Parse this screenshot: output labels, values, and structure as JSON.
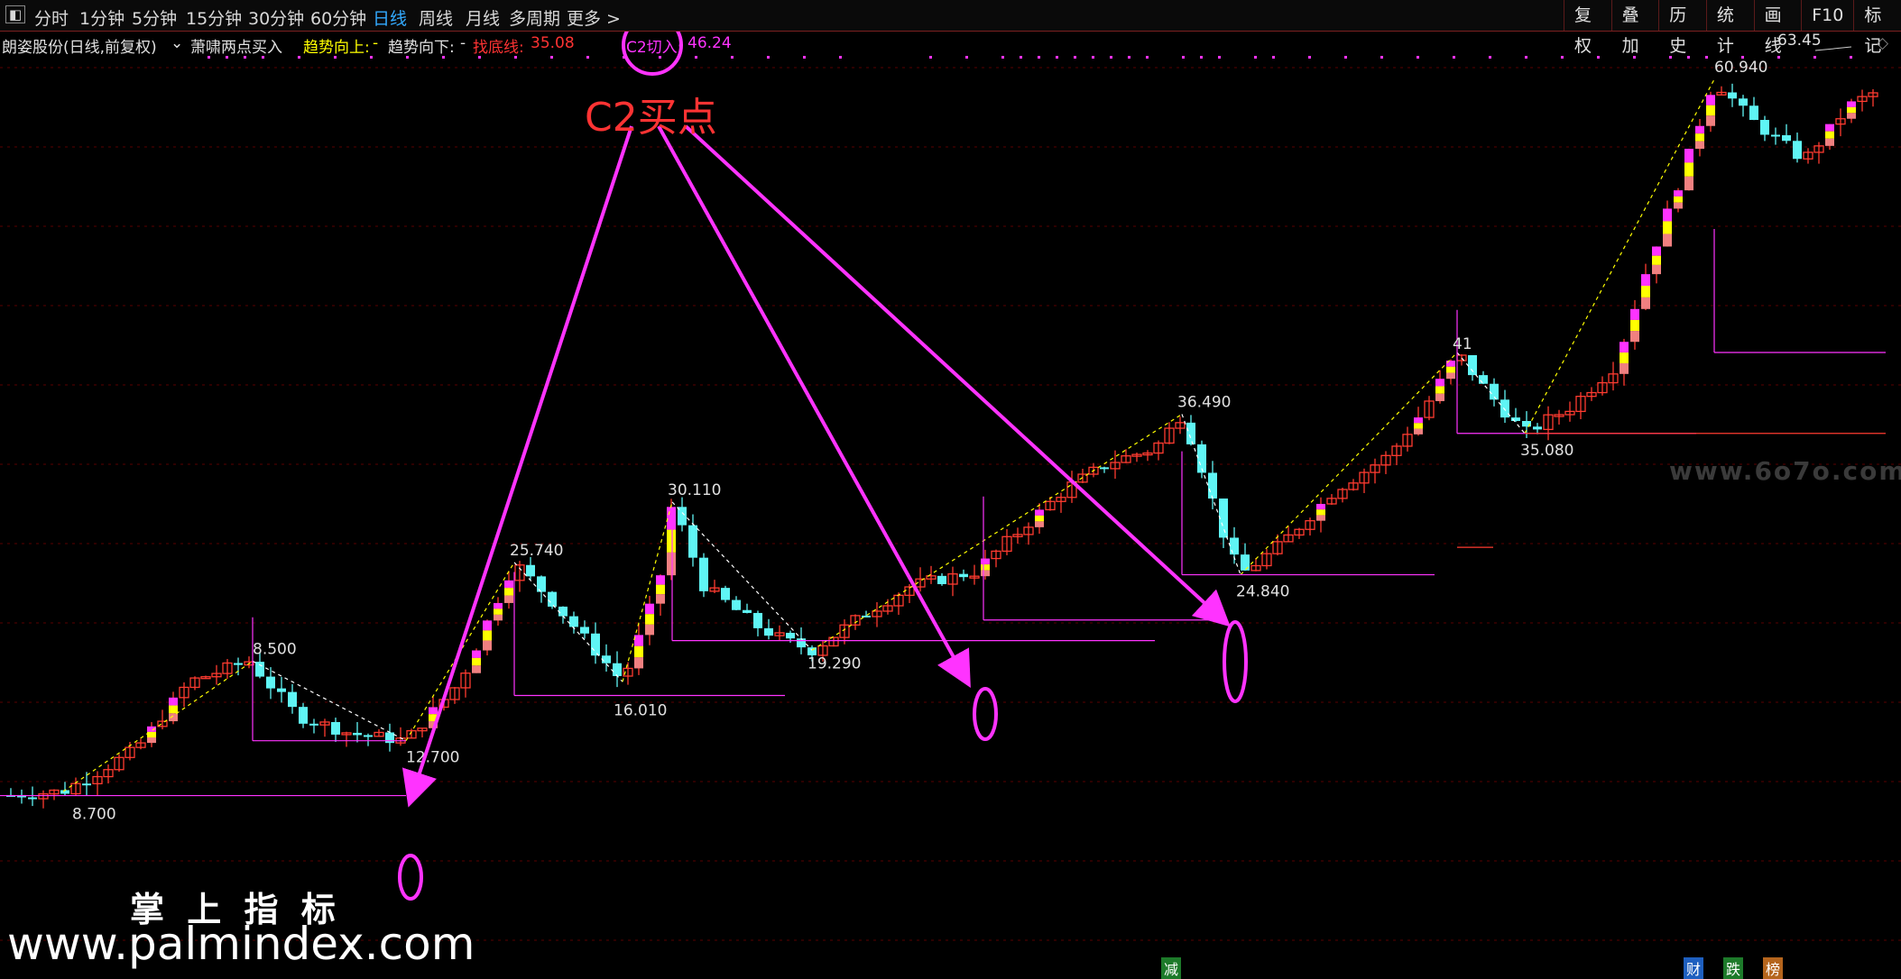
{
  "toolbar": {
    "periods": [
      "分时",
      "1分钟",
      "5分钟",
      "15分钟",
      "30分钟",
      "60分钟",
      "日线",
      "周线",
      "月线",
      "多周期",
      "更多 >"
    ],
    "active_period": "日线",
    "right_buttons": [
      "复权",
      "叠加",
      "历史",
      "统计",
      "画线",
      "F10",
      "标记"
    ]
  },
  "legend": {
    "stock": "朗姿股份(日线,前复权)",
    "indicator": "萧啸两点买入",
    "trend_up_label": "趋势向上:",
    "trend_up_value": "-",
    "trend_down_label": "趋势向下:",
    "trend_down_value": "-",
    "bottom_label": "找底线:",
    "bottom_value": "35.08",
    "c2_label": "C2切入:",
    "c2_value": "46.24"
  },
  "annotation": {
    "text": "C2买点"
  },
  "bottom_badges": [
    "减",
    "财",
    "跌",
    "榜"
  ],
  "watermarks": {
    "top_right": "www.6o7o.com",
    "bottom_cn": "掌 上 指 标",
    "bottom_url": "www.palmindex.com"
  },
  "colors": {
    "background": "#000000",
    "up_candle": "#ff3b30",
    "down_candle": "#5ff5f5",
    "magenta": "#ff33ff",
    "yellow": "#ffff00",
    "salmon": "#f08080",
    "annotation": "#ff3333",
    "active_tab": "#33aaff"
  },
  "chart_data": {
    "type": "candlestick",
    "peak_labels": [
      "8.500",
      "25.740",
      "30.110",
      "36.490",
      "41",
      "60.940",
      "63.45"
    ],
    "trough_labels": [
      "8.700",
      "12.700",
      "16.010",
      "19.290",
      "24.840",
      "35.080"
    ],
    "key_levels": {
      "找底线": 35.08,
      "C2切入": 46.24
    },
    "annotation": "C2买点"
  }
}
